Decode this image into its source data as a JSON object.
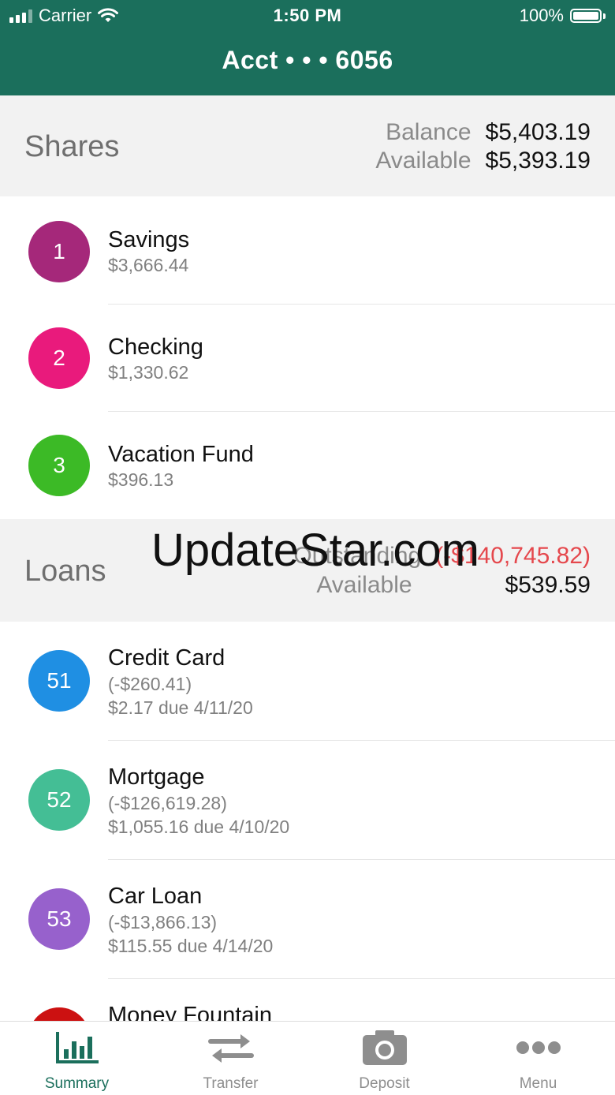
{
  "status_bar": {
    "carrier": "Carrier",
    "time": "1:50 PM",
    "battery": "100%"
  },
  "header": {
    "title": "Acct • • • 6056"
  },
  "shares": {
    "title": "Shares",
    "balance_label": "Balance",
    "balance_value": "$5,403.19",
    "available_label": "Available",
    "available_value": "$5,393.19",
    "items": [
      {
        "number": "1",
        "name": "Savings",
        "amount": "$3,666.44",
        "color": "#a5287a"
      },
      {
        "number": "2",
        "name": "Checking",
        "amount": "$1,330.62",
        "color": "#e91a7c"
      },
      {
        "number": "3",
        "name": "Vacation Fund",
        "amount": "$396.13",
        "color": "#3cba26"
      }
    ]
  },
  "loans": {
    "title": "Loans",
    "outstanding_label": "Outstanding",
    "outstanding_value": "(-$140,745.82)",
    "available_label": "Available",
    "available_value": "$539.59",
    "items": [
      {
        "number": "51",
        "name": "Credit Card",
        "balance": "(-$260.41)",
        "due": "$2.17 due 4/11/20",
        "color": "#1f8fe3"
      },
      {
        "number": "52",
        "name": "Mortgage",
        "balance": "(-$126,619.28)",
        "due": "$1,055.16 due 4/10/20",
        "color": "#44be95"
      },
      {
        "number": "53",
        "name": "Car Loan",
        "balance": "(-$13,866.13)",
        "due": "$115.55 due 4/14/20",
        "color": "#9761cc"
      },
      {
        "number": "",
        "name": "Money Fountain",
        "color": "#cc1111"
      }
    ]
  },
  "watermark": "UpdateStar.com",
  "tabs": [
    {
      "label": "Summary",
      "icon": "bar-chart-icon",
      "active": true
    },
    {
      "label": "Transfer",
      "icon": "transfer-arrows-icon",
      "active": false
    },
    {
      "label": "Deposit",
      "icon": "camera-icon",
      "active": false
    },
    {
      "label": "Menu",
      "icon": "more-dots-icon",
      "active": false
    }
  ],
  "colors": {
    "brand": "#1b6f5c",
    "negative": "#e5484d"
  }
}
